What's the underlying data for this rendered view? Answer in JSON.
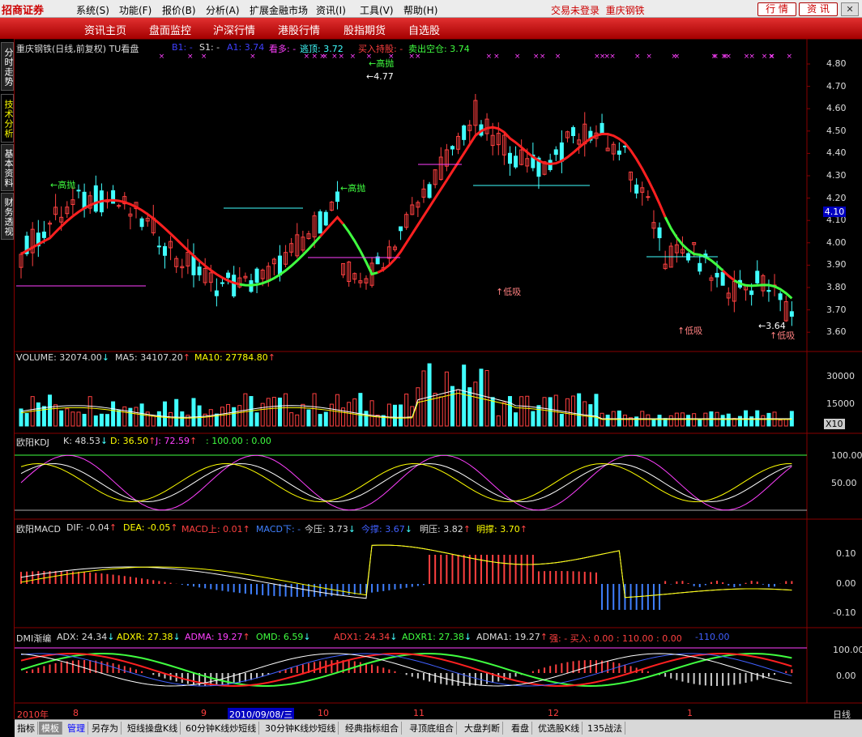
{
  "app": {
    "logo": "招商证券",
    "login": "交易未登录",
    "stock": "重庆钢铁",
    "btn_quote": "行 情",
    "btn_info": "资 讯"
  },
  "menu": [
    "系统(S)",
    "功能(F)",
    "报价(B)",
    "分析(A)",
    "扩展金融市场",
    "资讯(I)",
    "工具(V)",
    "帮助(H)"
  ],
  "nav": [
    "资讯主页",
    "盘面监控",
    "沪深行情",
    "港股行情",
    "股指期货",
    "自选股"
  ],
  "sidetabs": [
    "分时走势",
    "技术分析",
    "基本资料",
    "财务透视"
  ],
  "main": {
    "title": "重庆钢铁(日线,前复权) TU看盘",
    "b1": "B1: -",
    "s1": "S1: -",
    "a1": "A1: 3.74",
    "kd": "看多: -",
    "top": "逃顶: 3.72",
    "buyhold": "买入持股: -",
    "sellall": "卖出空仓: 3.74",
    "yticks": [
      "4.80",
      "4.70",
      "4.60",
      "4.50",
      "4.40",
      "4.30",
      "4.20",
      "4.10",
      "4.00",
      "3.90",
      "3.80",
      "3.70",
      "3.60"
    ],
    "price": "4.10",
    "high_label": "高抛",
    "low_label": "低吸",
    "val_477": "4.77",
    "val_364": "3.64"
  },
  "vol": {
    "volume": "VOLUME: 32074.00",
    "ma5": "MA5: 34107.20",
    "ma10": "MA10: 27784.80",
    "yticks": [
      "30000",
      "15000"
    ],
    "unit": "X10"
  },
  "kdj": {
    "name": "欧阳KDJ",
    "k": "K: 48.53",
    "d": "D: 36.50",
    "j": "J: 72.59",
    "e": ": 100.00 : 0.00",
    "yticks": [
      "100.00",
      "50.00"
    ]
  },
  "macd": {
    "name": "欧阳MACD",
    "dif": "DIF: -0.04",
    "dea": "DEA: -0.05",
    "up": "MACD上: 0.01",
    "down": "MACD下: -",
    "jinya": "今压: 3.73",
    "jincheng": "今撑: 3.67",
    "mingya": "明压: 3.82",
    "mingcheng": "明撑: 3.70",
    "yticks": [
      "0.10",
      "0.00",
      "-0.10"
    ]
  },
  "dmi": {
    "name": "DMI渐编",
    "adx": "ADX: 24.34",
    "adxr": "ADXR: 27.38",
    "adma": "ADMA: 19.27",
    "omd": "OMD: 6.59",
    "adx1": "ADX1: 24.34",
    "adxr1": "ADXR1: 27.38",
    "adma1": "ADMA1: 19.27",
    "qiang": "强: - 买入: 0.00 : 110.00 : 0.00",
    "neg": "-110.00",
    "yticks": [
      "100.00",
      "0.00"
    ]
  },
  "xaxis": {
    "labels": [
      "2010年",
      "8",
      "9",
      "2010/09/08/三",
      "10",
      "11",
      "12",
      "1"
    ],
    "period": "日线"
  },
  "bottom": [
    "指标",
    "模板",
    "管理",
    "另存为",
    "短线操盘K线",
    "60分钟K线炒短线",
    "30分钟K线炒短线",
    "经典指标组合",
    "寻顶底组合",
    "大盘判断",
    "看盘",
    "优选股K线",
    "135战法"
  ],
  "chart_data": {
    "type": "candlestick",
    "ylim": [
      3.55,
      4.85
    ],
    "last": 3.74,
    "high": 4.77,
    "low": 3.64
  }
}
